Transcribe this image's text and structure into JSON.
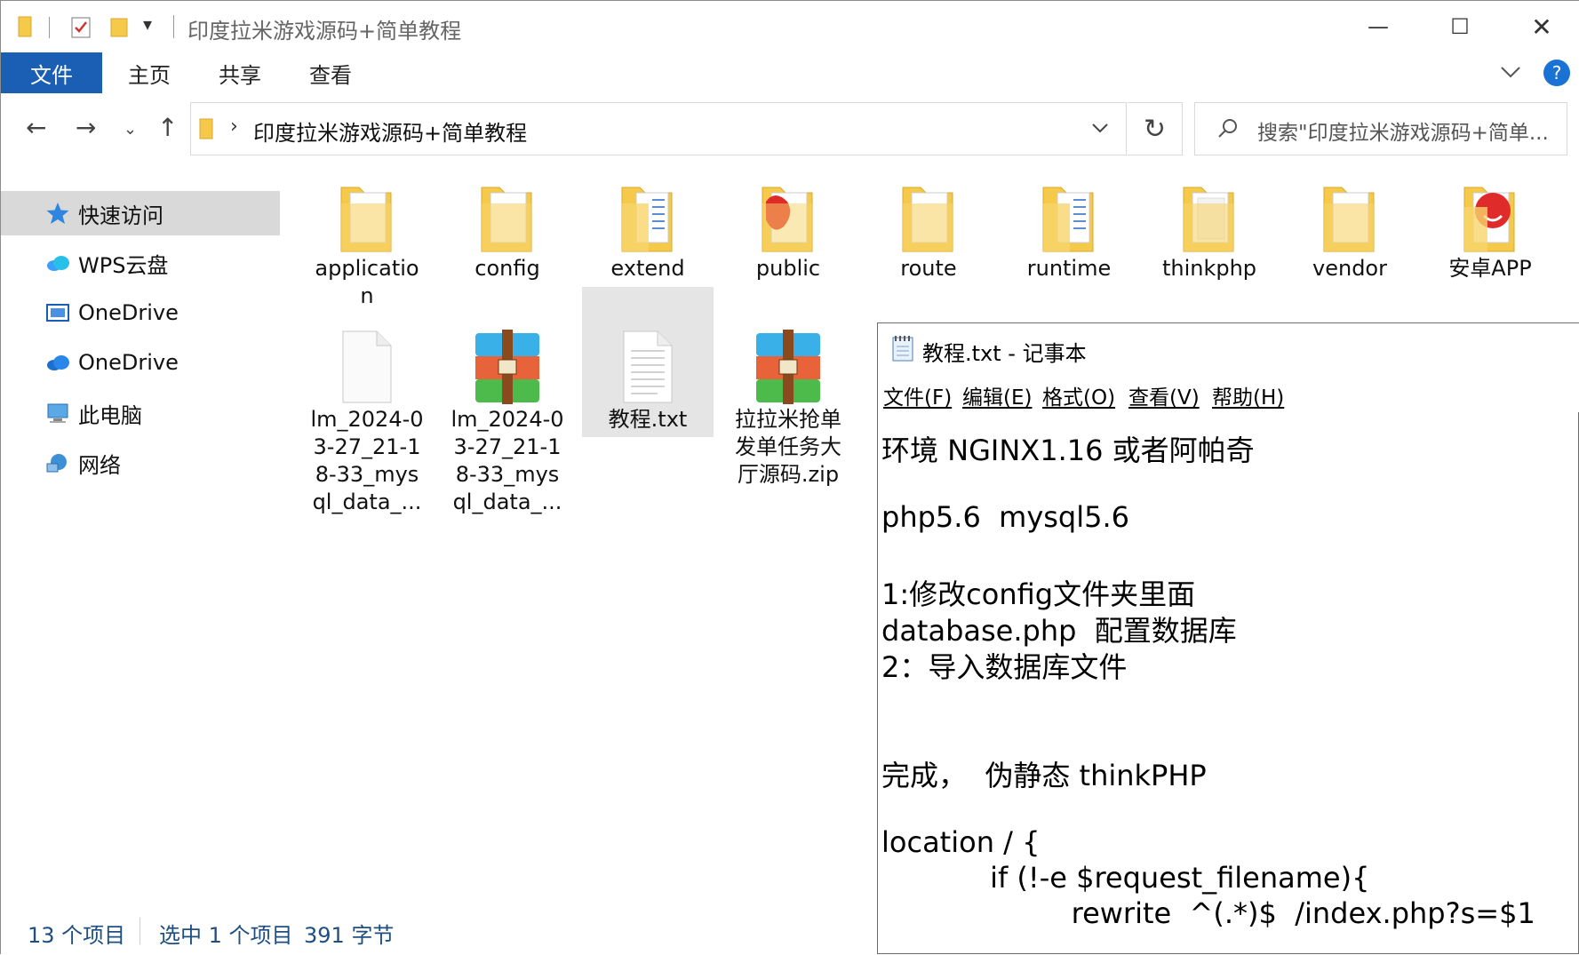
{
  "window": {
    "title": "印度拉米游戏源码+简单教程",
    "minimize": "—",
    "maximize": "☐",
    "close": "✕"
  },
  "ribbon": {
    "tabs": [
      "文件",
      "主页",
      "共享",
      "查看"
    ],
    "help": "?"
  },
  "address": {
    "path": "印度拉米游戏源码+简单教程",
    "search_placeholder": "搜索\"印度拉米游戏源码+简单..."
  },
  "sidebar": {
    "items": [
      {
        "label": "快速访问",
        "icon": "star-icon"
      },
      {
        "label": "WPS云盘",
        "icon": "cloud-icon"
      },
      {
        "label": "OneDrive",
        "icon": "onedrive-icon"
      },
      {
        "label": "OneDrive",
        "icon": "onedrive-icon"
      },
      {
        "label": "此电脑",
        "icon": "computer-icon"
      },
      {
        "label": "网络",
        "icon": "network-icon"
      }
    ]
  },
  "files": [
    {
      "name": "applicatio\nn",
      "type": "folder"
    },
    {
      "name": "config",
      "type": "folder"
    },
    {
      "name": "extend",
      "type": "folder"
    },
    {
      "name": "public",
      "type": "folder-app"
    },
    {
      "name": "route",
      "type": "folder"
    },
    {
      "name": "runtime",
      "type": "folder"
    },
    {
      "name": "thinkphp",
      "type": "folder"
    },
    {
      "name": "vendor",
      "type": "folder"
    },
    {
      "name": "安卓APP",
      "type": "folder-app"
    },
    {
      "name": "lm_2024-0\n3-27_21-1\n8-33_mys\nql_data_...",
      "type": "file"
    },
    {
      "name": "lm_2024-0\n3-27_21-1\n8-33_mys\nql_data_...",
      "type": "archive"
    },
    {
      "name": "教程.txt",
      "type": "text"
    },
    {
      "name": "拉拉米抢单\n发单任务大\n厅源码.zip",
      "type": "archive"
    }
  ],
  "status": {
    "count": "13 个项目",
    "selected": "选中 1 个项目",
    "size": "391 字节"
  },
  "notepad": {
    "title": "教程.txt - 记事本",
    "menu": [
      "文件(F)",
      "编辑(E)",
      "格式(O)",
      "查看(V)",
      "帮助(H)"
    ],
    "lines": [
      "环境 NGINX1.16 或者阿帕奇",
      "",
      "php5.6  mysql5.6",
      "",
      "1:修改config文件夹里面",
      "database.php  配置数据库",
      "2：导入数据库文件",
      "",
      "",
      "完成，  伪静态 thinkPHP",
      "",
      "location / {",
      "            if (!-e $request_filename){",
      "                     rewrite  ^(.*)$  /index.php?s=$1"
    ]
  },
  "colors": {
    "accent": "#1a5fb4",
    "folder": "#f5c94a",
    "selection": "#e5e5e5"
  }
}
